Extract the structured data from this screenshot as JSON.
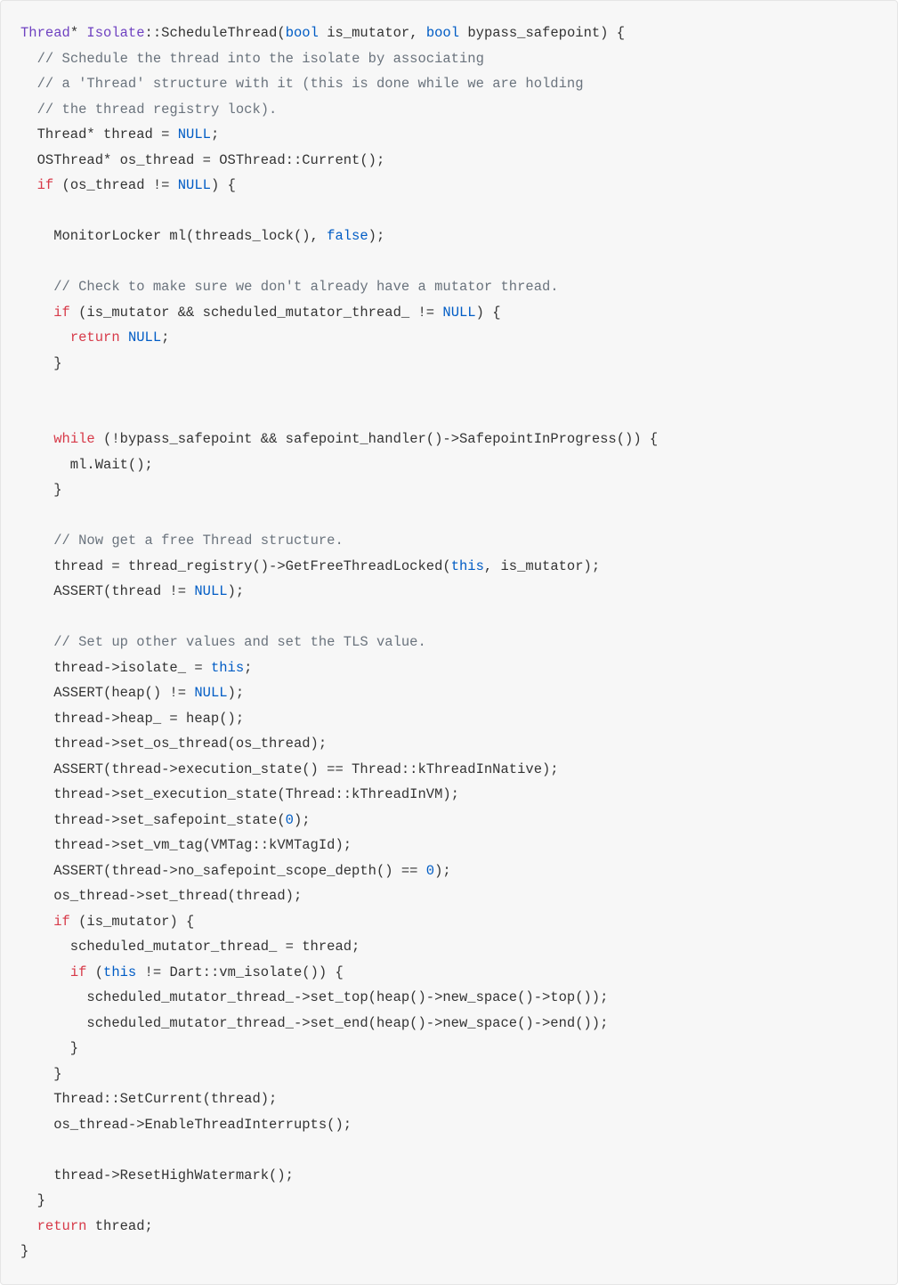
{
  "code": {
    "tokens": [
      {
        "t": "Thread",
        "c": "tok-type"
      },
      {
        "t": "* "
      },
      {
        "t": "Isolate",
        "c": "tok-type"
      },
      {
        "t": "::ScheduleThread("
      },
      {
        "t": "bool",
        "c": "tok-btype"
      },
      {
        "t": " is_mutator, "
      },
      {
        "t": "bool",
        "c": "tok-btype"
      },
      {
        "t": " bypass_safepoint) {\n"
      },
      {
        "t": "  "
      },
      {
        "t": "// Schedule the thread into the isolate by associating",
        "c": "tok-comment"
      },
      {
        "t": "\n"
      },
      {
        "t": "  "
      },
      {
        "t": "// a 'Thread' structure with it (this is done while we are holding",
        "c": "tok-comment"
      },
      {
        "t": "\n"
      },
      {
        "t": "  "
      },
      {
        "t": "// the thread registry lock).",
        "c": "tok-comment"
      },
      {
        "t": "\n"
      },
      {
        "t": "  Thread* thread = "
      },
      {
        "t": "NULL",
        "c": "tok-const"
      },
      {
        "t": ";\n"
      },
      {
        "t": "  OSThread* os_thread = OSThread::Current();\n"
      },
      {
        "t": "  "
      },
      {
        "t": "if",
        "c": "tok-keyword"
      },
      {
        "t": " (os_thread != "
      },
      {
        "t": "NULL",
        "c": "tok-const"
      },
      {
        "t": ") {\n"
      },
      {
        "t": "\n"
      },
      {
        "t": "    MonitorLocker ml(threads_lock(), "
      },
      {
        "t": "false",
        "c": "tok-const"
      },
      {
        "t": ");\n"
      },
      {
        "t": "\n"
      },
      {
        "t": "    "
      },
      {
        "t": "// Check to make sure we don't already have a mutator thread.",
        "c": "tok-comment"
      },
      {
        "t": "\n"
      },
      {
        "t": "    "
      },
      {
        "t": "if",
        "c": "tok-keyword"
      },
      {
        "t": " (is_mutator && scheduled_mutator_thread_ != "
      },
      {
        "t": "NULL",
        "c": "tok-const"
      },
      {
        "t": ") {\n"
      },
      {
        "t": "      "
      },
      {
        "t": "return",
        "c": "tok-keyword"
      },
      {
        "t": " "
      },
      {
        "t": "NULL",
        "c": "tok-const"
      },
      {
        "t": ";\n"
      },
      {
        "t": "    }\n"
      },
      {
        "t": "\n"
      },
      {
        "t": "\n"
      },
      {
        "t": "    "
      },
      {
        "t": "while",
        "c": "tok-keyword"
      },
      {
        "t": " (!bypass_safepoint && safepoint_handler()->SafepointInProgress()) {\n"
      },
      {
        "t": "      ml.Wait();\n"
      },
      {
        "t": "    }\n"
      },
      {
        "t": "\n"
      },
      {
        "t": "    "
      },
      {
        "t": "// Now get a free Thread structure.",
        "c": "tok-comment"
      },
      {
        "t": "\n"
      },
      {
        "t": "    thread = thread_registry()->GetFreeThreadLocked("
      },
      {
        "t": "this",
        "c": "tok-this"
      },
      {
        "t": ", is_mutator);\n"
      },
      {
        "t": "    ASSERT(thread != "
      },
      {
        "t": "NULL",
        "c": "tok-const"
      },
      {
        "t": ");\n"
      },
      {
        "t": "\n"
      },
      {
        "t": "    "
      },
      {
        "t": "// Set up other values and set the TLS value.",
        "c": "tok-comment"
      },
      {
        "t": "\n"
      },
      {
        "t": "    thread->isolate_ = "
      },
      {
        "t": "this",
        "c": "tok-this"
      },
      {
        "t": ";\n"
      },
      {
        "t": "    ASSERT(heap() != "
      },
      {
        "t": "NULL",
        "c": "tok-const"
      },
      {
        "t": ");\n"
      },
      {
        "t": "    thread->heap_ = heap();\n"
      },
      {
        "t": "    thread->set_os_thread(os_thread);\n"
      },
      {
        "t": "    ASSERT(thread->execution_state() == Thread::kThreadInNative);\n"
      },
      {
        "t": "    thread->set_execution_state(Thread::kThreadInVM);\n"
      },
      {
        "t": "    thread->set_safepoint_state("
      },
      {
        "t": "0",
        "c": "tok-num"
      },
      {
        "t": ");\n"
      },
      {
        "t": "    thread->set_vm_tag(VMTag::kVMTagId);\n"
      },
      {
        "t": "    ASSERT(thread->no_safepoint_scope_depth() == "
      },
      {
        "t": "0",
        "c": "tok-num"
      },
      {
        "t": ");\n"
      },
      {
        "t": "    os_thread->set_thread(thread);\n"
      },
      {
        "t": "    "
      },
      {
        "t": "if",
        "c": "tok-keyword"
      },
      {
        "t": " (is_mutator) {\n"
      },
      {
        "t": "      scheduled_mutator_thread_ = thread;\n"
      },
      {
        "t": "      "
      },
      {
        "t": "if",
        "c": "tok-keyword"
      },
      {
        "t": " ("
      },
      {
        "t": "this",
        "c": "tok-this"
      },
      {
        "t": " != Dart::vm_isolate()) {\n"
      },
      {
        "t": "        scheduled_mutator_thread_->set_top(heap()->new_space()->top());\n"
      },
      {
        "t": "        scheduled_mutator_thread_->set_end(heap()->new_space()->end());\n"
      },
      {
        "t": "      }\n"
      },
      {
        "t": "    }\n"
      },
      {
        "t": "    Thread::SetCurrent(thread);\n"
      },
      {
        "t": "    os_thread->EnableThreadInterrupts();\n"
      },
      {
        "t": "\n"
      },
      {
        "t": "    thread->ResetHighWatermark();\n"
      },
      {
        "t": "  }\n"
      },
      {
        "t": "  "
      },
      {
        "t": "return",
        "c": "tok-keyword"
      },
      {
        "t": " thread;\n"
      },
      {
        "t": "}"
      }
    ]
  }
}
